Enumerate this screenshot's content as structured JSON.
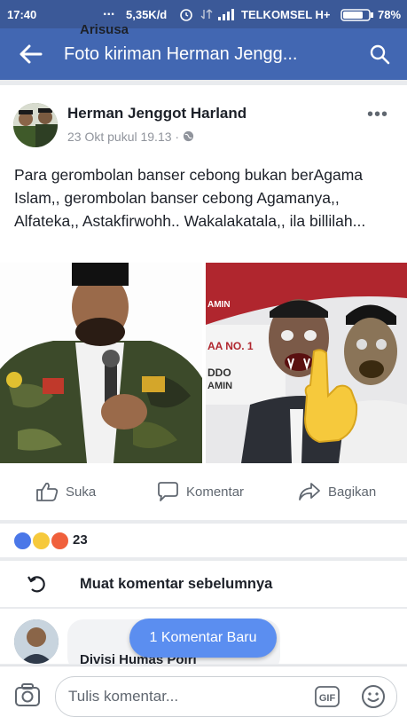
{
  "status_bar": {
    "time": "17:40",
    "dots": "...",
    "speed": "5,35K/d",
    "carrier": "TELKOMSEL H+",
    "battery": "78%"
  },
  "app_bar": {
    "title": "Foto kiriman Herman Jengg..."
  },
  "post": {
    "author": "Herman Jenggot Harland",
    "timestamp": "23 Okt pukul 19.13 · ",
    "text": "Para gerombolan banser cebong bukan berAgama Islam,, gerombolan banser cebong Agamanya,, Alfateka,, Astakfirwohh.. Wakalakatala,, ila billilah...",
    "image2_texts": [
      "AMIN",
      "AA NO. 1",
      "DDO",
      "AMIN"
    ]
  },
  "actions": {
    "like": "Suka",
    "comment": "Komentar",
    "share": "Bagikan"
  },
  "reactions": {
    "count": "23"
  },
  "load_more": "Muat komentar sebelumnya",
  "comment": {
    "name": "Arisusa",
    "subtitle": "Divisi Humas Polri"
  },
  "new_comment_pill": "1 Komentar Baru",
  "composer": {
    "placeholder": "Tulis komentar...",
    "gif_label": "GIF"
  },
  "colors": {
    "status_bar": "#3b5998",
    "app_bar": "#4267b2",
    "pill": "#5b8ef0"
  }
}
